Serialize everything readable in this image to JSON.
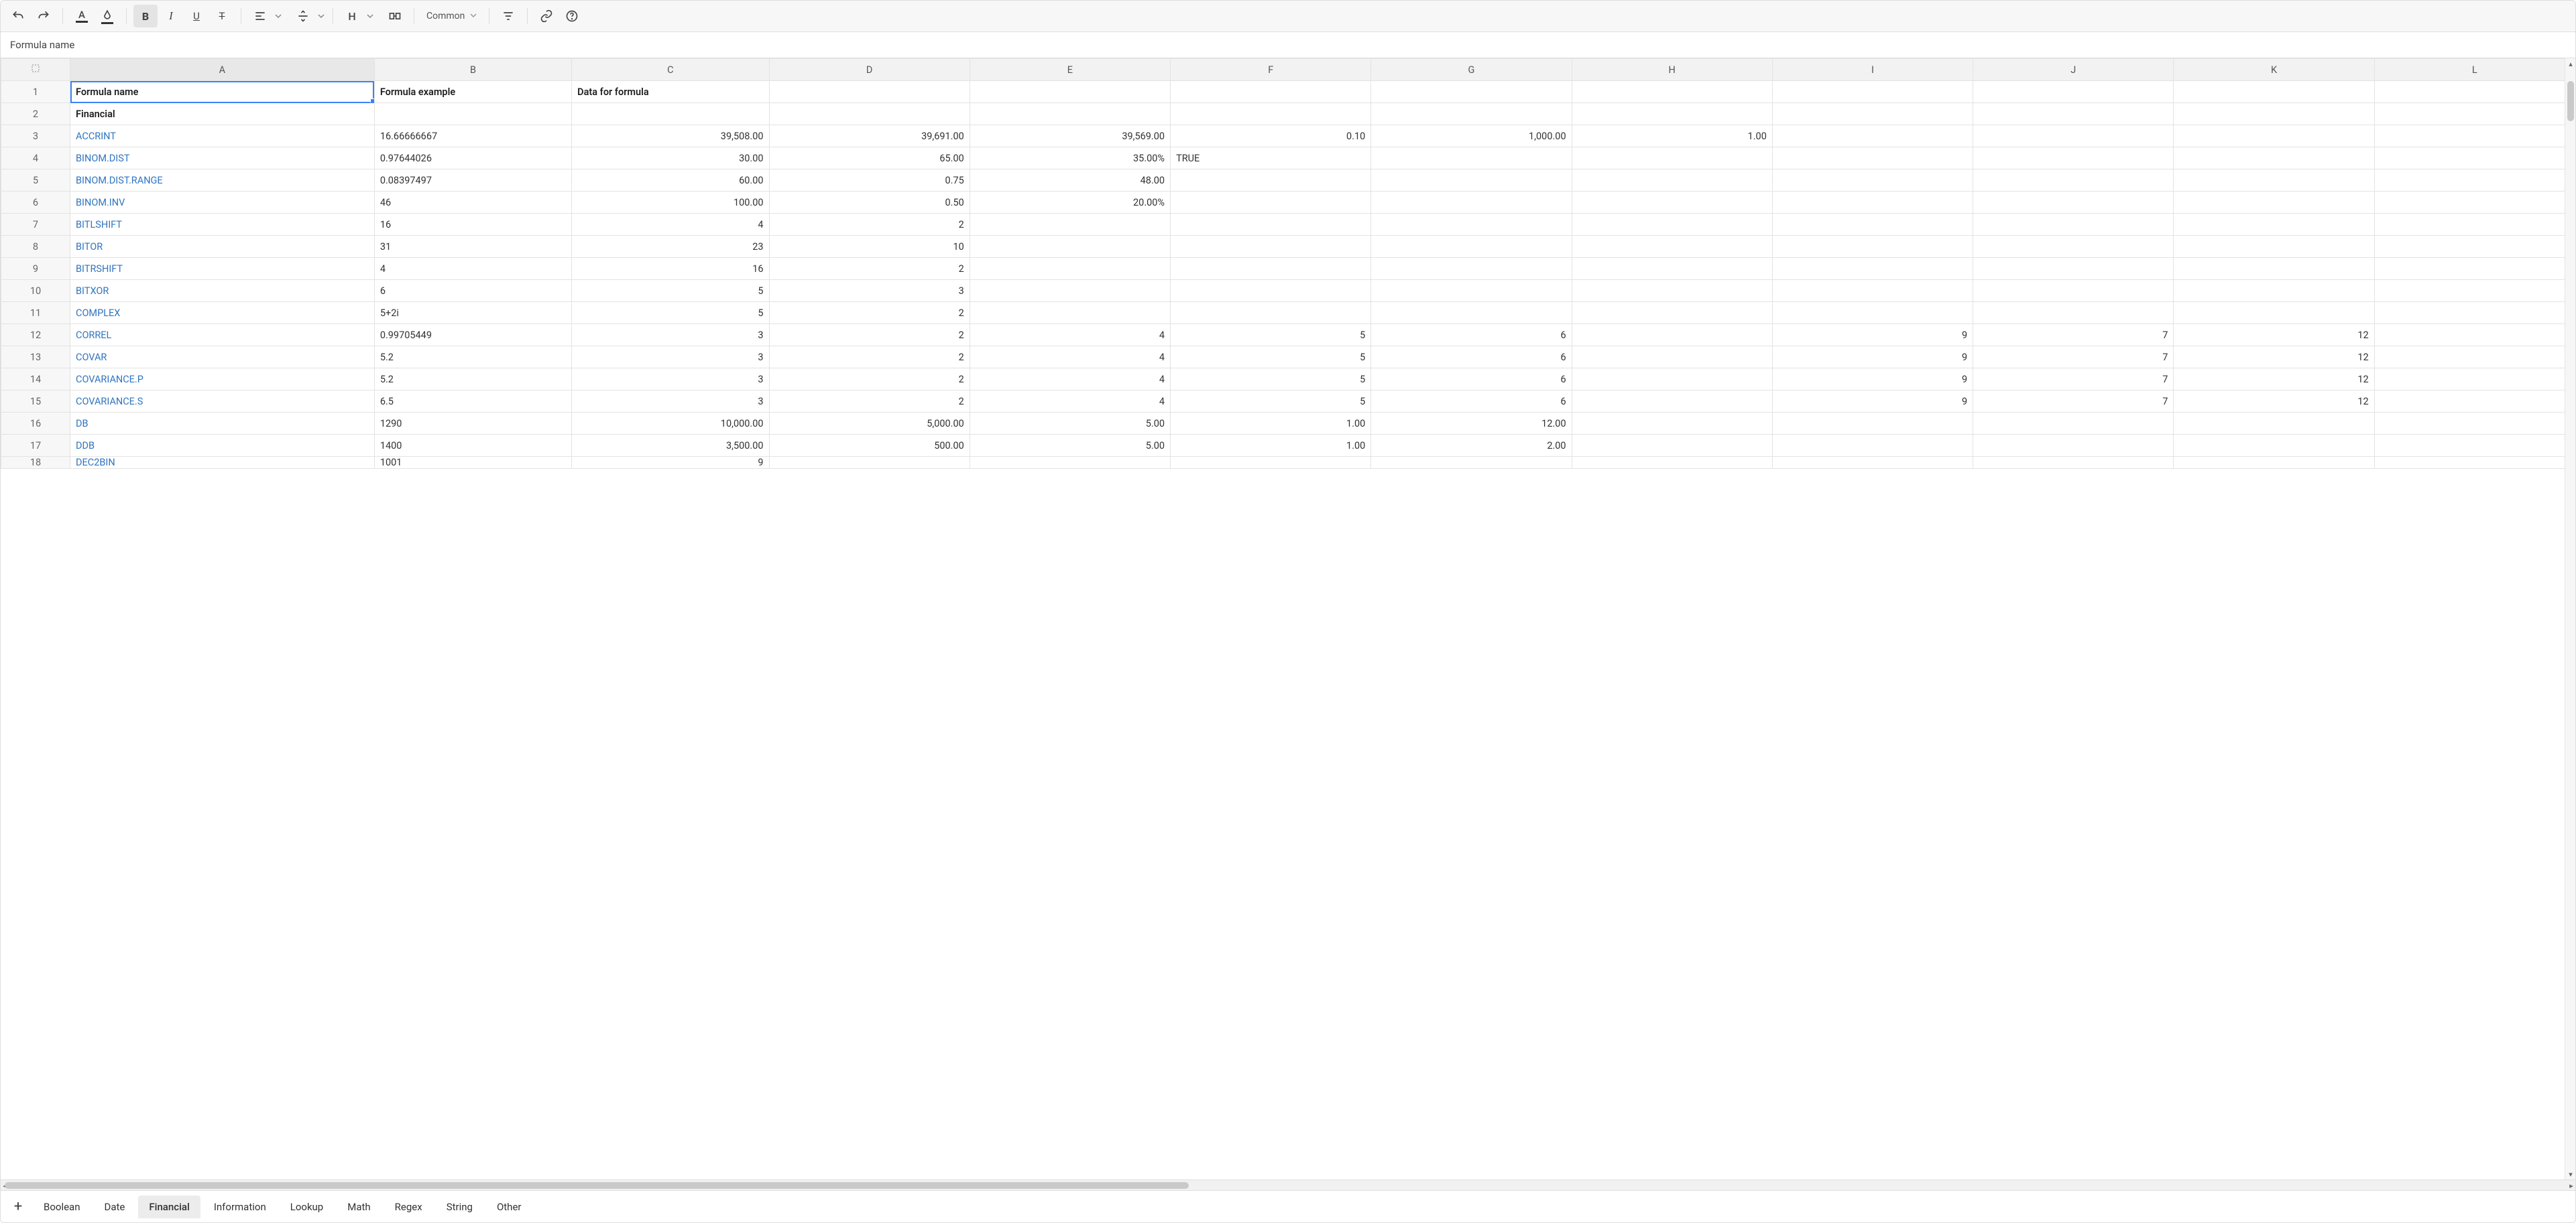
{
  "toolbar": {
    "font_family_label": "Common"
  },
  "formula_bar": {
    "value": "Formula name"
  },
  "columns": [
    "A",
    "B",
    "C",
    "D",
    "E",
    "F",
    "G",
    "H",
    "I",
    "J",
    "K",
    "L"
  ],
  "selected_column": "A",
  "selected_cell": {
    "row": 1,
    "col": "A"
  },
  "rows": [
    {
      "n": 1,
      "cells": {
        "A": {
          "v": "Formula name",
          "bold": true
        },
        "B": {
          "v": "Formula example",
          "bold": true
        },
        "C": {
          "v": "Data for formula",
          "bold": true,
          "align": "left"
        }
      }
    },
    {
      "n": 2,
      "cells": {
        "A": {
          "v": "Financial",
          "bold": true
        }
      }
    },
    {
      "n": 3,
      "cells": {
        "A": {
          "v": "ACCRINT",
          "link": true
        },
        "B": {
          "v": "16.66666667"
        },
        "C": {
          "v": "39,508.00",
          "num": true
        },
        "D": {
          "v": "39,691.00",
          "num": true
        },
        "E": {
          "v": "39,569.00",
          "num": true
        },
        "F": {
          "v": "0.10",
          "num": true
        },
        "G": {
          "v": "1,000.00",
          "num": true
        },
        "H": {
          "v": "1.00",
          "num": true
        }
      }
    },
    {
      "n": 4,
      "cells": {
        "A": {
          "v": "BINOM.DIST",
          "link": true
        },
        "B": {
          "v": "0.97644026"
        },
        "C": {
          "v": "30.00",
          "num": true
        },
        "D": {
          "v": "65.00",
          "num": true
        },
        "E": {
          "v": "35.00%",
          "num": true
        },
        "F": {
          "v": "TRUE"
        }
      }
    },
    {
      "n": 5,
      "cells": {
        "A": {
          "v": "BINOM.DIST.RANGE",
          "link": true
        },
        "B": {
          "v": "0.08397497"
        },
        "C": {
          "v": "60.00",
          "num": true
        },
        "D": {
          "v": "0.75",
          "num": true
        },
        "E": {
          "v": "48.00",
          "num": true
        }
      }
    },
    {
      "n": 6,
      "cells": {
        "A": {
          "v": "BINOM.INV",
          "link": true
        },
        "B": {
          "v": "46"
        },
        "C": {
          "v": "100.00",
          "num": true
        },
        "D": {
          "v": "0.50",
          "num": true
        },
        "E": {
          "v": "20.00%",
          "num": true
        }
      }
    },
    {
      "n": 7,
      "cells": {
        "A": {
          "v": "BITLSHIFT",
          "link": true
        },
        "B": {
          "v": "16"
        },
        "C": {
          "v": "4",
          "num": true
        },
        "D": {
          "v": "2",
          "num": true
        }
      }
    },
    {
      "n": 8,
      "cells": {
        "A": {
          "v": "BITOR",
          "link": true
        },
        "B": {
          "v": "31"
        },
        "C": {
          "v": "23",
          "num": true
        },
        "D": {
          "v": "10",
          "num": true
        }
      }
    },
    {
      "n": 9,
      "cells": {
        "A": {
          "v": "BITRSHIFT",
          "link": true
        },
        "B": {
          "v": "4"
        },
        "C": {
          "v": "16",
          "num": true
        },
        "D": {
          "v": "2",
          "num": true
        }
      }
    },
    {
      "n": 10,
      "cells": {
        "A": {
          "v": "BITXOR",
          "link": true
        },
        "B": {
          "v": "6"
        },
        "C": {
          "v": "5",
          "num": true
        },
        "D": {
          "v": "3",
          "num": true
        }
      }
    },
    {
      "n": 11,
      "cells": {
        "A": {
          "v": "COMPLEX",
          "link": true
        },
        "B": {
          "v": "5+2i"
        },
        "C": {
          "v": "5",
          "num": true
        },
        "D": {
          "v": "2",
          "num": true
        }
      }
    },
    {
      "n": 12,
      "cells": {
        "A": {
          "v": "CORREL",
          "link": true
        },
        "B": {
          "v": "0.99705449"
        },
        "C": {
          "v": "3",
          "num": true
        },
        "D": {
          "v": "2",
          "num": true
        },
        "E": {
          "v": "4",
          "num": true
        },
        "F": {
          "v": "5",
          "num": true
        },
        "G": {
          "v": "6",
          "num": true
        },
        "I": {
          "v": "9",
          "num": true
        },
        "J": {
          "v": "7",
          "num": true
        },
        "K": {
          "v": "12",
          "num": true
        }
      }
    },
    {
      "n": 13,
      "cells": {
        "A": {
          "v": "COVAR",
          "link": true
        },
        "B": {
          "v": "5.2"
        },
        "C": {
          "v": "3",
          "num": true
        },
        "D": {
          "v": "2",
          "num": true
        },
        "E": {
          "v": "4",
          "num": true
        },
        "F": {
          "v": "5",
          "num": true
        },
        "G": {
          "v": "6",
          "num": true
        },
        "I": {
          "v": "9",
          "num": true
        },
        "J": {
          "v": "7",
          "num": true
        },
        "K": {
          "v": "12",
          "num": true
        }
      }
    },
    {
      "n": 14,
      "cells": {
        "A": {
          "v": "COVARIANCE.P",
          "link": true
        },
        "B": {
          "v": "5.2"
        },
        "C": {
          "v": "3",
          "num": true
        },
        "D": {
          "v": "2",
          "num": true
        },
        "E": {
          "v": "4",
          "num": true
        },
        "F": {
          "v": "5",
          "num": true
        },
        "G": {
          "v": "6",
          "num": true
        },
        "I": {
          "v": "9",
          "num": true
        },
        "J": {
          "v": "7",
          "num": true
        },
        "K": {
          "v": "12",
          "num": true
        }
      }
    },
    {
      "n": 15,
      "cells": {
        "A": {
          "v": "COVARIANCE.S",
          "link": true
        },
        "B": {
          "v": "6.5"
        },
        "C": {
          "v": "3",
          "num": true
        },
        "D": {
          "v": "2",
          "num": true
        },
        "E": {
          "v": "4",
          "num": true
        },
        "F": {
          "v": "5",
          "num": true
        },
        "G": {
          "v": "6",
          "num": true
        },
        "I": {
          "v": "9",
          "num": true
        },
        "J": {
          "v": "7",
          "num": true
        },
        "K": {
          "v": "12",
          "num": true
        }
      }
    },
    {
      "n": 16,
      "cells": {
        "A": {
          "v": "DB",
          "link": true
        },
        "B": {
          "v": "1290"
        },
        "C": {
          "v": "10,000.00",
          "num": true
        },
        "D": {
          "v": "5,000.00",
          "num": true
        },
        "E": {
          "v": "5.00",
          "num": true
        },
        "F": {
          "v": "1.00",
          "num": true
        },
        "G": {
          "v": "12.00",
          "num": true
        }
      }
    },
    {
      "n": 17,
      "cells": {
        "A": {
          "v": "DDB",
          "link": true
        },
        "B": {
          "v": "1400"
        },
        "C": {
          "v": "3,500.00",
          "num": true
        },
        "D": {
          "v": "500.00",
          "num": true
        },
        "E": {
          "v": "5.00",
          "num": true
        },
        "F": {
          "v": "1.00",
          "num": true
        },
        "G": {
          "v": "2.00",
          "num": true
        }
      }
    }
  ],
  "partial_row": {
    "n": 18,
    "cells": {
      "A": {
        "v": "DEC2BIN",
        "link": true
      },
      "B": {
        "v": "1001"
      },
      "C": {
        "v": "9",
        "num": true
      }
    }
  },
  "sheet_tabs": [
    {
      "label": "Boolean",
      "active": false
    },
    {
      "label": "Date",
      "active": false
    },
    {
      "label": "Financial",
      "active": true
    },
    {
      "label": "Information",
      "active": false
    },
    {
      "label": "Lookup",
      "active": false
    },
    {
      "label": "Math",
      "active": false
    },
    {
      "label": "Regex",
      "active": false
    },
    {
      "label": "String",
      "active": false
    },
    {
      "label": "Other",
      "active": false
    }
  ]
}
